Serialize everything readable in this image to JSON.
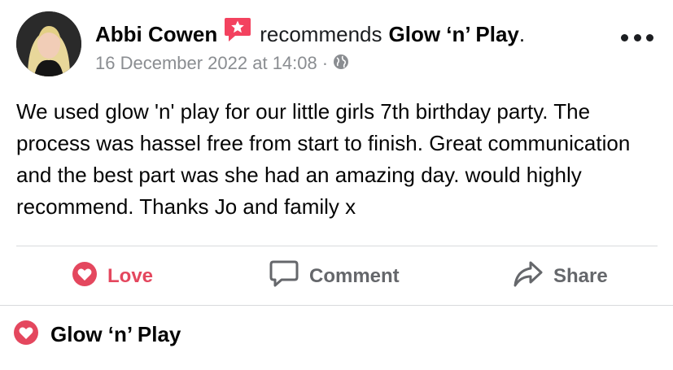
{
  "post": {
    "author": "Abbi Cowen",
    "verb": "recommends",
    "page_name": "Glow ‘n’ Play",
    "period": ".",
    "timestamp": "16 December 2022 at 14:08",
    "separator": "·",
    "privacy_icon": "globe-icon",
    "body": "We used glow 'n' play for our little girls 7th birthday party. The process was hassel free from start to finish. Great communication and the best part was she had an amazing day. would highly recommend. Thanks Jo and family x"
  },
  "actions": {
    "love_label": "Love",
    "comment_label": "Comment",
    "share_label": "Share"
  },
  "footer": {
    "page_name": "Glow ‘n’ Play"
  },
  "colors": {
    "love": "#e4475e",
    "recommend_badge": "#f3425f",
    "muted": "#65676b",
    "meta": "#8a8d91"
  }
}
